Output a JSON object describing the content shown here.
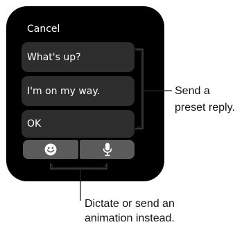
{
  "watch": {
    "cancel_label": "Cancel",
    "replies": [
      "What's up?",
      "I'm on my way.",
      "OK"
    ],
    "buttons": [
      {
        "icon": "smiley-icon"
      },
      {
        "icon": "microphone-icon"
      }
    ]
  },
  "callouts": {
    "preset_line1": "Send a",
    "preset_line2": "preset reply.",
    "dictate_line1": "Dictate or send an",
    "dictate_line2": "animation instead."
  },
  "colors": {
    "screen": "#000000",
    "reply_bg": "#2d2d2d",
    "button_bg": "#5b5b5b",
    "text": "#ffffff"
  }
}
